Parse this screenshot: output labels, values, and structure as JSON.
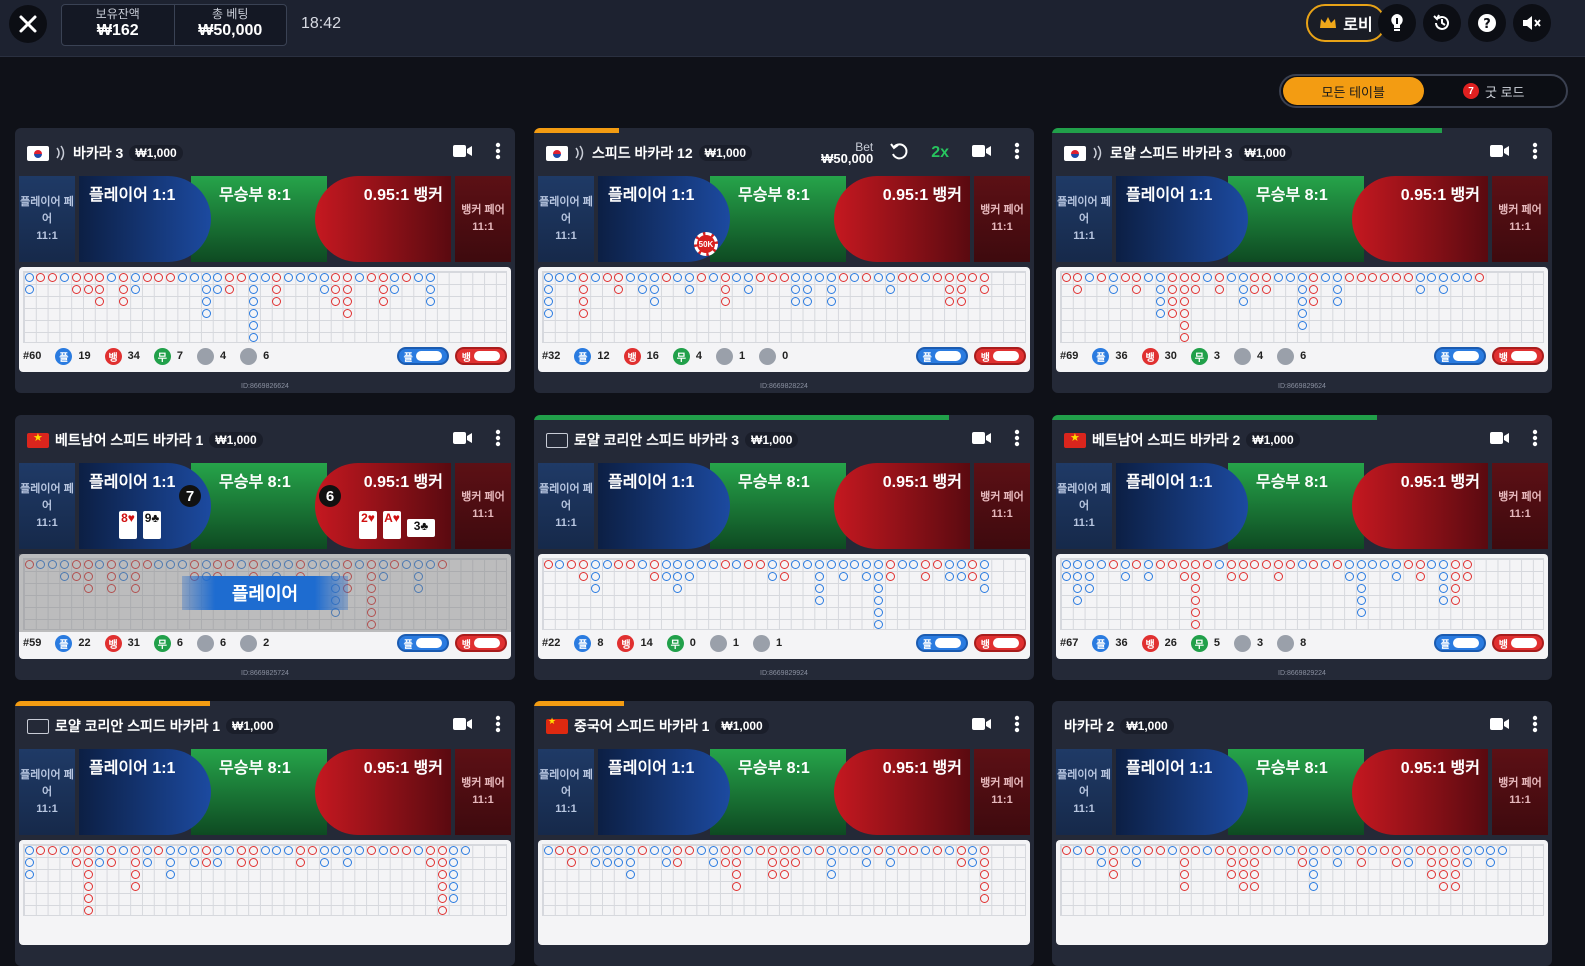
{
  "topbar": {
    "balance_label": "보유잔액",
    "balance_value": "₩162",
    "total_bet_label": "총 베팅",
    "total_bet_value": "₩50,000",
    "time": "18:42",
    "lobby_label": "로비",
    "icons": [
      "close-icon",
      "crown-icon",
      "lightbulb-icon",
      "history-icon",
      "help-icon",
      "mute-icon"
    ]
  },
  "filter": {
    "all_tables": "모든 테이블",
    "good_road": "굿 로드",
    "good_road_count": "7"
  },
  "labels": {
    "player_pair": "플레이어 페어",
    "banker_pair": "뱅커 페어",
    "pair_odds": "11:1",
    "player": "플레이어 1:1",
    "tie": "무승부 8:1",
    "banker": "0.95:1 뱅커",
    "stat_p": "플",
    "stat_b": "뱅",
    "stat_t": "무",
    "bet_label": "Bet",
    "multiplier": "2x",
    "result_player": "플레이어"
  },
  "colors": {
    "accent": "#f39c12",
    "player": "#2a7be0",
    "banker": "#e03030",
    "tie": "#21a04a"
  },
  "tables": [
    {
      "name": "바카라 3",
      "bet": "₩1,000",
      "flag": "kr",
      "squeeze": true,
      "progress": null,
      "round": "#60",
      "p": "19",
      "b": "34",
      "t": "7",
      "pp": "4",
      "bp": "6",
      "id": "ID:8669826624"
    },
    {
      "name": "스피드 바카라 12",
      "bet": "₩1,000",
      "flag": "kr",
      "squeeze": true,
      "progress": 0.17,
      "progress_color": "#f39c12",
      "active_bet": "₩50,000",
      "chip": "50K",
      "round": "#32",
      "p": "12",
      "b": "16",
      "t": "4",
      "pp": "1",
      "bp": "0",
      "id": "ID:8669828224"
    },
    {
      "name": "로얄 스피드 바카라 3",
      "bet": "₩1,000",
      "flag": "kr",
      "squeeze": true,
      "progress": 0.78,
      "progress_color": "#21a04a",
      "round": "#69",
      "p": "36",
      "b": "30",
      "t": "3",
      "pp": "4",
      "bp": "6",
      "id": "ID:8669829624"
    },
    {
      "name": "베트남어 스피드 바카라 1",
      "bet": "₩1,000",
      "flag": "vn",
      "squeeze": false,
      "progress": null,
      "cards": true,
      "player_score": "7",
      "banker_score": "6",
      "player_cards": [
        "8♥",
        "9♣"
      ],
      "banker_cards": [
        "2♥",
        "A♥",
        "3♣"
      ],
      "result": "플레이어",
      "round": "#59",
      "p": "22",
      "b": "31",
      "t": "6",
      "pp": "6",
      "bp": "2",
      "id": "ID:8669825724"
    },
    {
      "name": "로얄 코리안 스피드 바카라 3",
      "bet": "₩1,000",
      "flag": "blank",
      "squeeze": false,
      "progress": 0.83,
      "progress_color": "#21a04a",
      "round": "#22",
      "p": "8",
      "b": "14",
      "t": "0",
      "pp": "1",
      "bp": "1",
      "id": "ID:8669829924"
    },
    {
      "name": "베트남어 스피드 바카라 2",
      "bet": "₩1,000",
      "flag": "vn",
      "squeeze": false,
      "progress": 0.65,
      "progress_color": "#21a04a",
      "round": "#67",
      "p": "36",
      "b": "26",
      "t": "5",
      "pp": "3",
      "bp": "8",
      "id": "ID:8669829224"
    },
    {
      "name": "로얄 코리안 스피드 바카라 1",
      "bet": "₩1,000",
      "flag": "blank",
      "squeeze": false,
      "progress": 0.39,
      "progress_color": "#f39c12"
    },
    {
      "name": "중국어 스피드 바카라 1",
      "bet": "₩1,000",
      "flag": "cn",
      "squeeze": false,
      "progress": 0.18,
      "progress_color": "#f39c12"
    },
    {
      "name": "바카라 2",
      "bet": "₩1,000",
      "flag": "none",
      "squeeze": false,
      "progress": null
    }
  ]
}
